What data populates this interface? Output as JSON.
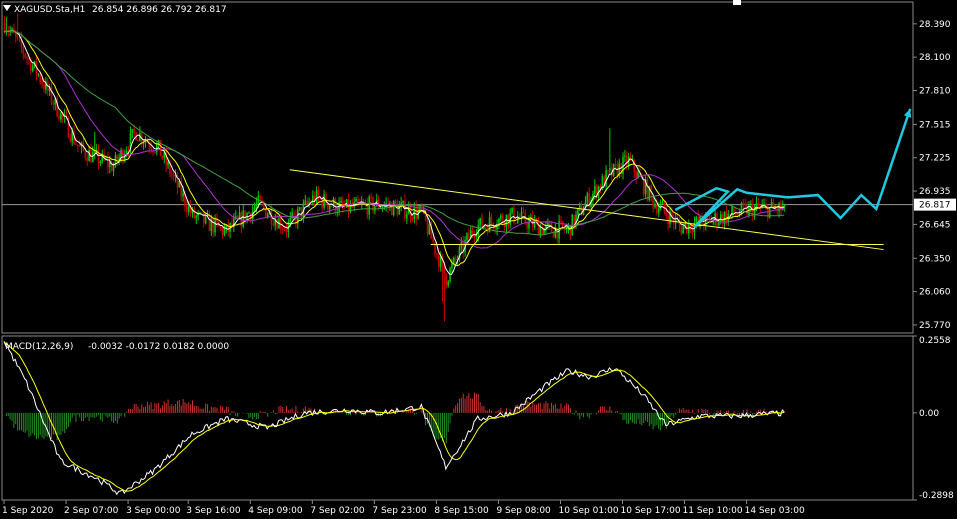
{
  "header": {
    "symbol": "XAGUSD.Sta,H1",
    "ohlc": "26.854 26.896 26.792 26.817"
  },
  "macd_header": {
    "label": "MACD(12,26,9)",
    "values": "-0.0032 -0.0172 0.0182 0.0000"
  },
  "price_axis": {
    "ticks": [
      "28.390",
      "28.100",
      "27.810",
      "27.515",
      "27.225",
      "26.935",
      "26.645",
      "26.350",
      "26.060",
      "25.770"
    ],
    "current": "26.817"
  },
  "macd_axis": {
    "ticks": [
      "0.2558",
      "0.00",
      "-0.2898"
    ]
  },
  "time_axis": {
    "ticks": [
      "1 Sep 2020",
      "2 Sep 07:00",
      "3 Sep 00:00",
      "3 Sep 16:00",
      "4 Sep 09:00",
      "7 Sep 02:00",
      "7 Sep 23:00",
      "8 Sep 15:00",
      "9 Sep 08:00",
      "10 Sep 01:00",
      "10 Sep 17:00",
      "11 Sep 10:00",
      "14 Sep 03:00"
    ]
  },
  "colors": {
    "background": "#000000",
    "bull": "#00c800",
    "bear": "#c80000",
    "ma_fast": "#ffffff",
    "ma_mid": "#ffff00",
    "ma_slow": "#b030d0",
    "ma_long": "#40a040",
    "trend": "#ffff50",
    "arrow": "#20c8e0",
    "hist_pos": "#d03030",
    "hist_neg": "#209020"
  },
  "chart_data": {
    "type": "candlestick",
    "title": "XAGUSD.Sta,H1",
    "ylim": [
      25.7,
      28.58
    ],
    "close_anchors": [
      [
        0,
        28.4
      ],
      [
        18,
        27.95
      ],
      [
        40,
        27.3
      ],
      [
        58,
        27.15
      ],
      [
        70,
        27.45
      ],
      [
        82,
        27.3
      ],
      [
        100,
        26.72
      ],
      [
        118,
        26.58
      ],
      [
        135,
        26.82
      ],
      [
        150,
        26.62
      ],
      [
        165,
        26.88
      ],
      [
        180,
        26.78
      ],
      [
        200,
        26.82
      ],
      [
        222,
        26.74
      ],
      [
        235,
        26.18
      ],
      [
        250,
        26.62
      ],
      [
        270,
        26.72
      ],
      [
        288,
        26.6
      ],
      [
        300,
        26.6
      ],
      [
        310,
        26.85
      ],
      [
        320,
        27.05
      ],
      [
        332,
        27.2
      ],
      [
        345,
        26.85
      ],
      [
        360,
        26.62
      ],
      [
        380,
        26.7
      ],
      [
        398,
        26.78
      ],
      [
        415,
        26.78
      ]
    ],
    "current_price": 26.817,
    "macd": {
      "ylim": [
        -0.2898,
        0.2558
      ],
      "macd_anchors": [
        [
          0,
          0.24
        ],
        [
          12,
          0.1
        ],
        [
          30,
          -0.16
        ],
        [
          50,
          -0.22
        ],
        [
          62,
          -0.27
        ],
        [
          80,
          -0.19
        ],
        [
          100,
          -0.07
        ],
        [
          118,
          -0.02
        ],
        [
          140,
          -0.05
        ],
        [
          160,
          0.0
        ],
        [
          182,
          0.01
        ],
        [
          200,
          0.0
        ],
        [
          222,
          0.02
        ],
        [
          235,
          -0.18
        ],
        [
          252,
          -0.02
        ],
        [
          270,
          0.0
        ],
        [
          288,
          0.09
        ],
        [
          300,
          0.14
        ],
        [
          312,
          0.12
        ],
        [
          325,
          0.15
        ],
        [
          340,
          0.06
        ],
        [
          352,
          -0.04
        ],
        [
          370,
          -0.01
        ],
        [
          390,
          -0.01
        ],
        [
          415,
          0.0
        ]
      ],
      "signal_lag": 9
    },
    "trendlines": [
      {
        "from": [
          152,
          27.12
        ],
        "to": [
          420,
          26.6
        ]
      },
      {
        "from": [
          227,
          26.47
        ],
        "to": [
          420,
          26.47
        ]
      }
    ],
    "projection": [
      [
        357,
        26.77
      ],
      [
        379,
        26.96
      ],
      [
        385,
        26.93
      ],
      [
        367,
        26.62
      ],
      [
        390,
        26.95
      ],
      [
        395,
        26.92
      ],
      [
        417,
        26.88
      ],
      [
        433,
        26.9
      ],
      [
        445,
        26.7
      ],
      [
        456,
        26.9
      ],
      [
        464,
        26.78
      ],
      [
        482,
        27.65
      ]
    ]
  }
}
